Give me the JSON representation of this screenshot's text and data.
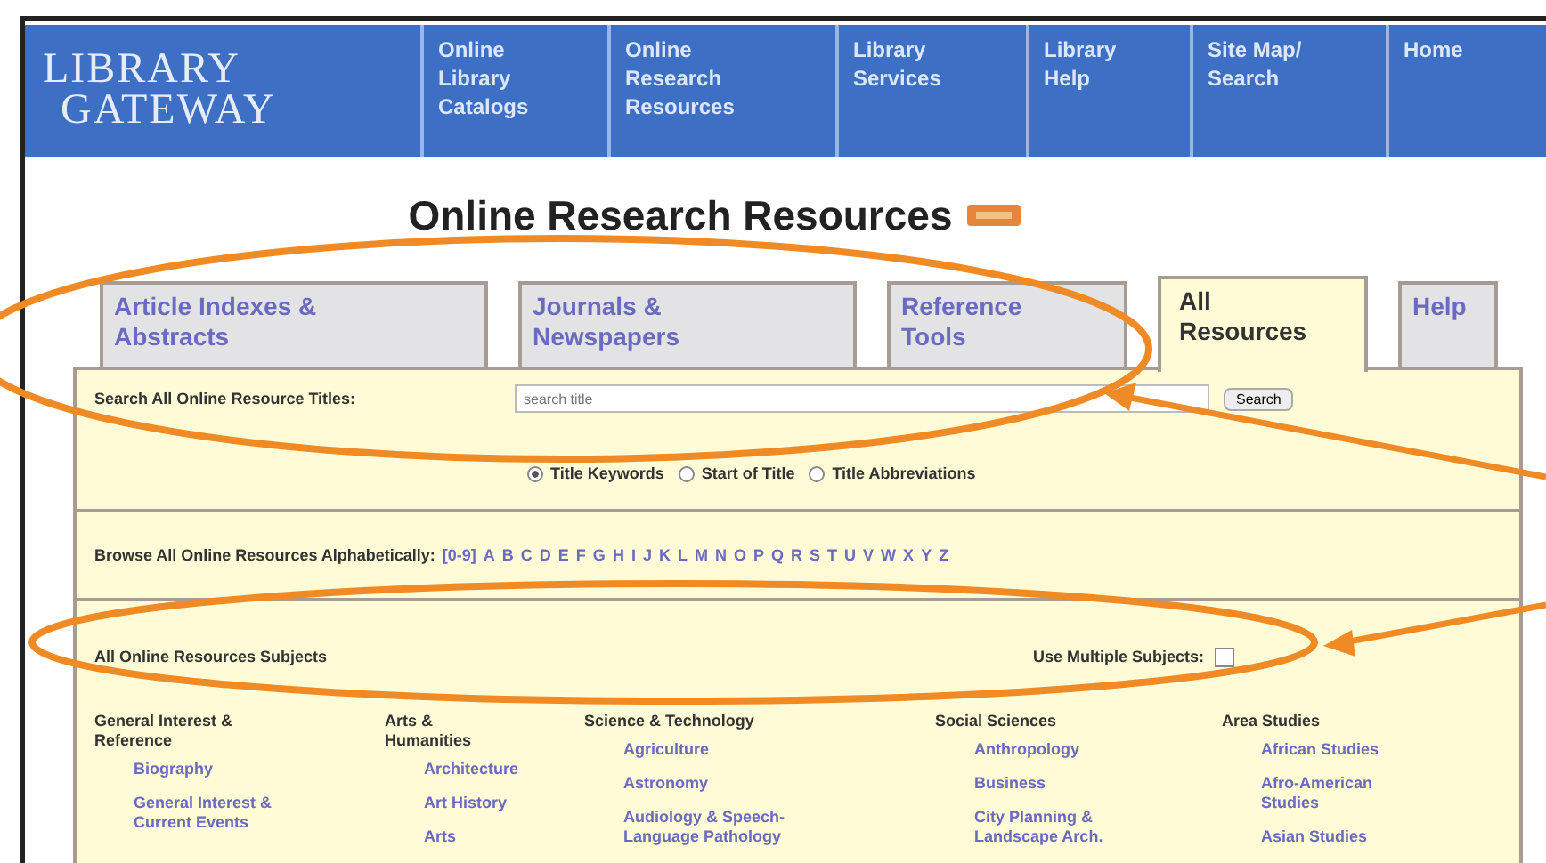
{
  "header": {
    "logo": {
      "line_1": "LIBRARY",
      "line_2": "GATEWAY"
    },
    "nav": [
      {
        "label": "Online Library Catalogs"
      },
      {
        "label": "Online Research Resources"
      },
      {
        "label": "Library Services"
      },
      {
        "label": "Library Help"
      },
      {
        "label": "Site Map/ Search"
      },
      {
        "label": "Home"
      }
    ]
  },
  "page_title": "Online Research Resources",
  "tabs": [
    {
      "label": "Article Indexes & Abstracts",
      "selected": false
    },
    {
      "label": "Journals & Newspapers",
      "selected": false
    },
    {
      "label": "Reference Tools",
      "selected": false
    },
    {
      "label": "All Resources",
      "selected": true
    },
    {
      "label": "Help",
      "selected": false
    }
  ],
  "search": {
    "label": "Search All Online Resource Titles:",
    "value": "search title",
    "button": "Search",
    "options": [
      {
        "label": "Title Keywords",
        "selected": true
      },
      {
        "label": "Start of Title",
        "selected": false
      },
      {
        "label": "Title Abbreviations",
        "selected": false
      }
    ]
  },
  "browse": {
    "label": "Browse All Online Resources Alphabetically:",
    "letters": [
      "[0-9]",
      "A",
      "B",
      "C",
      "D",
      "E",
      "F",
      "G",
      "H",
      "I",
      "J",
      "K",
      "L",
      "M",
      "N",
      "O",
      "P",
      "Q",
      "R",
      "S",
      "T",
      "U",
      "V",
      "W",
      "X",
      "Y",
      "Z"
    ]
  },
  "subjects": {
    "label": "All Online Resources Subjects",
    "multiple_label": "Use Multiple Subjects:",
    "multiple_checked": false,
    "columns": [
      {
        "heading": "General Interest & Reference",
        "items": [
          "Biography",
          "General Interest & Current Events"
        ]
      },
      {
        "heading": "Arts & Humanities",
        "items": [
          "Architecture",
          "Art History",
          "Arts"
        ]
      },
      {
        "heading": "Science & Technology",
        "items": [
          "Agriculture",
          "Astronomy",
          "Audiology & Speech-Language Pathology"
        ]
      },
      {
        "heading": "Social Sciences",
        "items": [
          "Anthropology",
          "Business",
          "City Planning & Landscape Arch."
        ]
      },
      {
        "heading": "Area Studies",
        "items": [
          "African Studies",
          "Afro-American Studies",
          "Asian Studies"
        ]
      }
    ]
  }
}
